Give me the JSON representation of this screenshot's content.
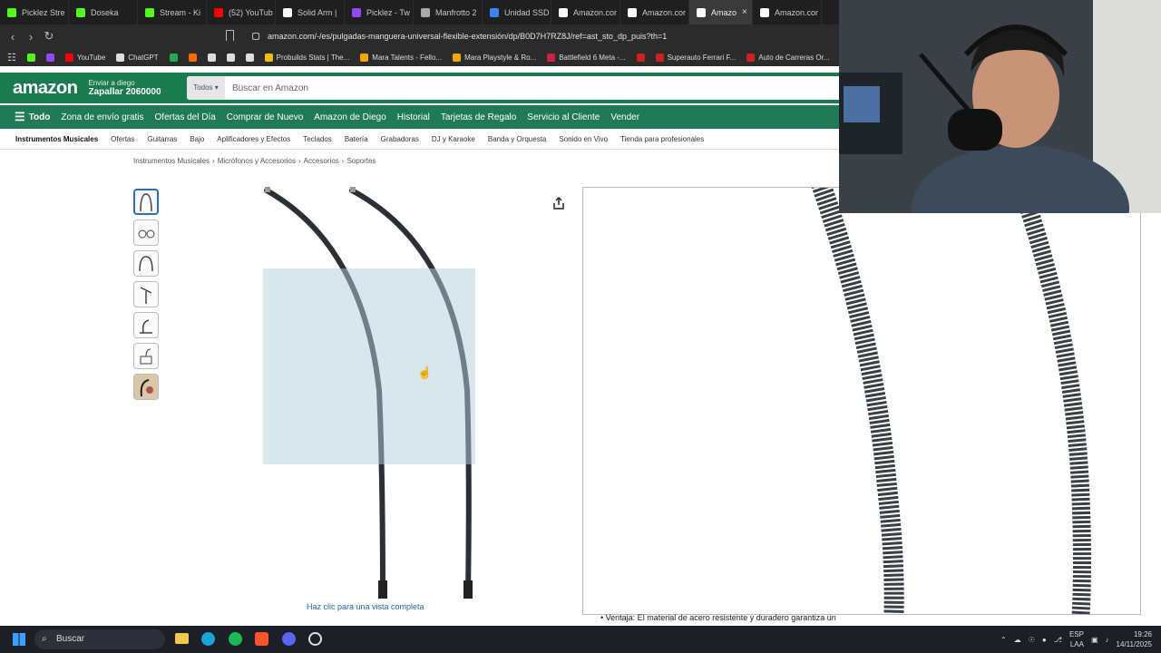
{
  "tabs": [
    {
      "label": "Picklez Stre",
      "color": "#53fc18"
    },
    {
      "label": "Doseka",
      "color": "#53fc18"
    },
    {
      "label": "Stream - Ki",
      "color": "#53fc18"
    },
    {
      "label": "(52) YouTub",
      "color": "#ff0000"
    },
    {
      "label": "Solid Arm |",
      "color": "#ffffff"
    },
    {
      "label": "Picklez - Tw",
      "color": "#9146ff"
    },
    {
      "label": "Manfrotto 2",
      "color": "#aaaaaa"
    },
    {
      "label": "Unidad SSD",
      "color": "#3b82f6"
    },
    {
      "label": "Amazon.cor",
      "color": "#ffffff"
    },
    {
      "label": "Amazon.cor",
      "color": "#ffffff"
    },
    {
      "label": "Amazo",
      "color": "#ffffff",
      "active": true
    },
    {
      "label": "Amazon.cor",
      "color": "#ffffff"
    }
  ],
  "tab_close": "×",
  "url": "amazon.com/-/es/pulgadas-manguera-universal-flexible-extensión/dp/B0D7H7RZ8J/ref=ast_sto_dp_puis?th=1",
  "bookmarks": [
    {
      "label": "",
      "color": "#53fc18"
    },
    {
      "label": "",
      "color": "#9146ff"
    },
    {
      "label": "YouTube",
      "color": "#ff0000"
    },
    {
      "label": "ChatGPT",
      "color": "#dddddd"
    },
    {
      "label": "",
      "color": "#22aa55"
    },
    {
      "label": "",
      "color": "#ff6a00"
    },
    {
      "label": "",
      "color": "#dddddd"
    },
    {
      "label": "",
      "color": "#dddddd"
    },
    {
      "label": "",
      "color": "#dddddd"
    },
    {
      "label": "Probuilds Stats | The...",
      "color": "#f0c000"
    },
    {
      "label": "Mara Talents - Fello...",
      "color": "#f7a600"
    },
    {
      "label": "Mara Playstyle & Ro...",
      "color": "#f7a600"
    },
    {
      "label": "Battlefield 6 Meta -...",
      "color": "#cc2244"
    },
    {
      "label": "",
      "color": "#cc2222"
    },
    {
      "label": "Superauto Ferrari F...",
      "color": "#cc2222"
    },
    {
      "label": "Auto de Carreras Or...",
      "color": "#cc2222"
    }
  ],
  "amazon": {
    "logo": "amazon",
    "deliver_line1": "Enviar a diego",
    "deliver_line2": "Zapallar 2060000",
    "search_category": "Todos",
    "search_placeholder": "Buscar en Amazon",
    "nav_all": "Todo",
    "nav": [
      "Zona de envío gratis",
      "Ofertas del Día",
      "Comprar de Nuevo",
      "Amazon de Diego",
      "Historial",
      "Tarjetas de Regalo",
      "Servicio al Cliente",
      "Vender"
    ],
    "subnav": [
      "Instrumentos Musicales",
      "Ofertas",
      "Guitarras",
      "Bajo",
      "Aplificadores y Efectos",
      "Teclados",
      "Batería",
      "Grabadoras",
      "DJ y Karaoke",
      "Banda y Orquesta",
      "Sonido en Vivo",
      "Tienda para profesionales"
    ],
    "breadcrumb": [
      "Instrumentos Musicales",
      "Micrófonos y Accesorios",
      "Accesorios",
      "Soportes"
    ],
    "breadcrumb_sep": "›",
    "full_view": "Haz clic para una vista completa",
    "below_text": "Ventaja: El material de acero resistente y duradero garantiza un"
  },
  "taskbar": {
    "search": "Buscar",
    "lang1": "ESP",
    "lang2": "LAA",
    "time": "19:26",
    "date": "14/11/2025"
  }
}
